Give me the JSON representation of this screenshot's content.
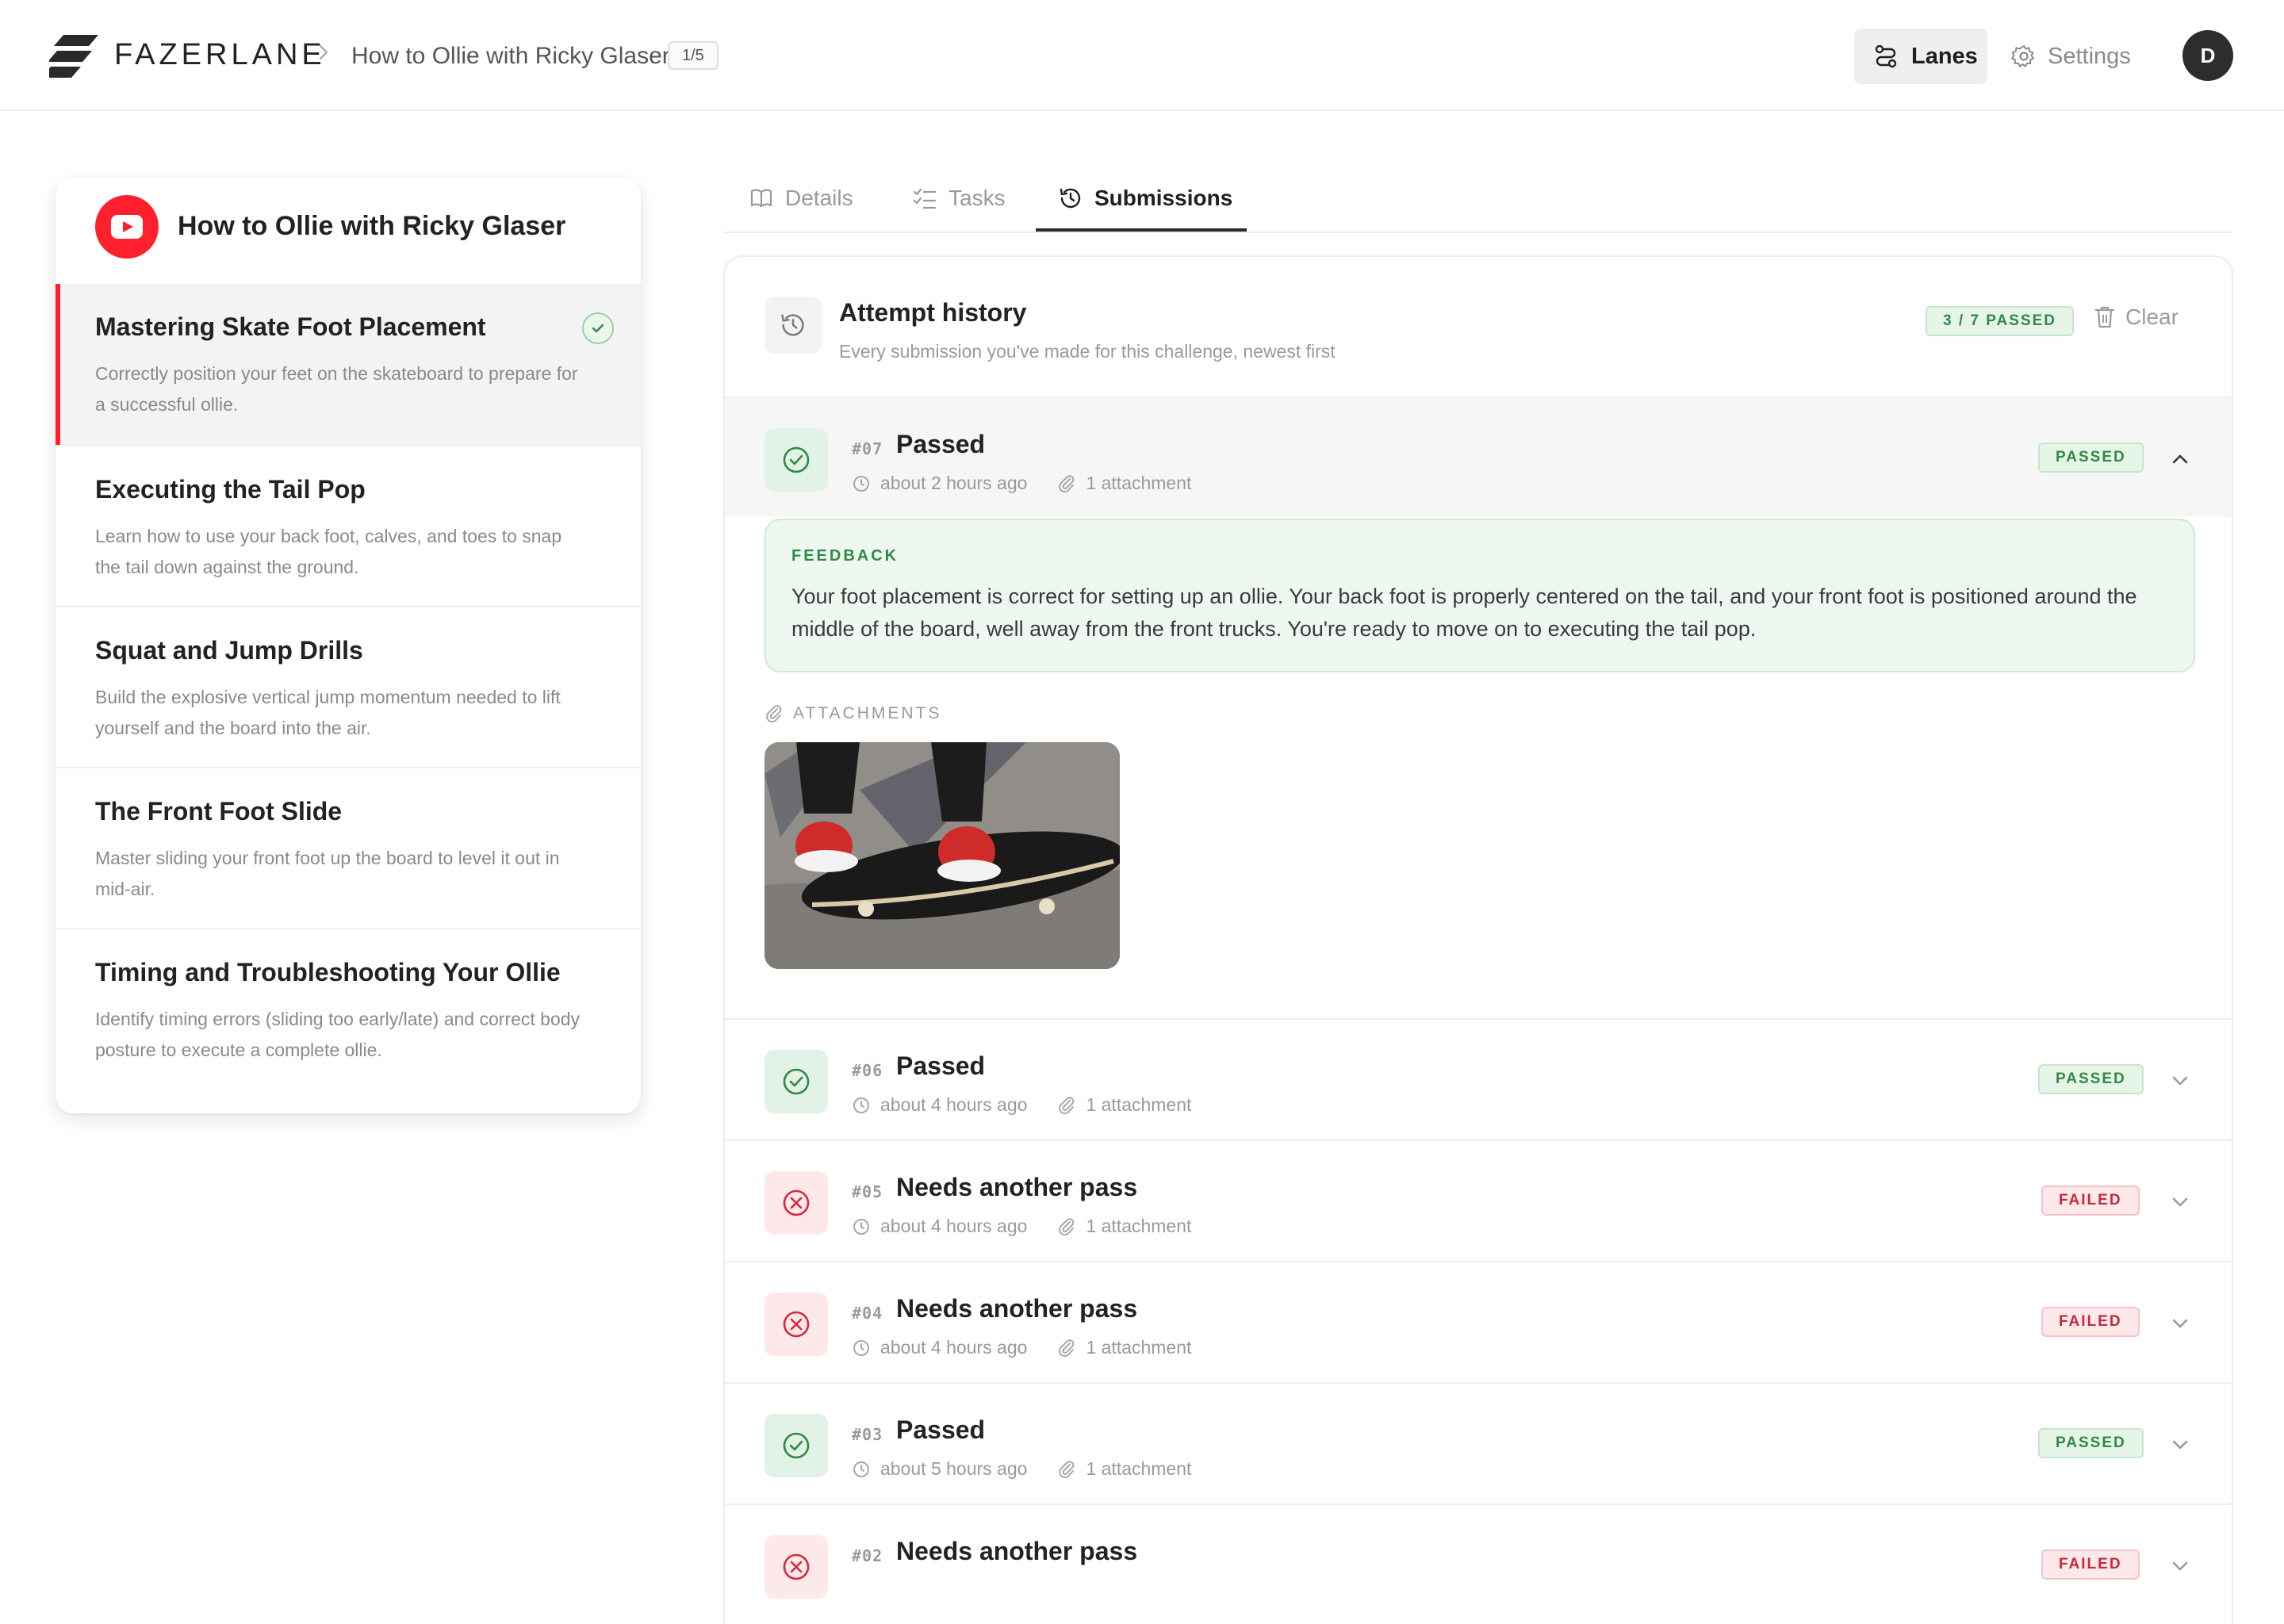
{
  "header": {
    "brand": "FAZERLANE",
    "breadcrumb": "How to Ollie with Ricky Glaser",
    "breadcrumb_count": "1/5",
    "nav": {
      "lanes": "Lanes",
      "settings": "Settings"
    },
    "avatar_initial": "D"
  },
  "lessons_panel": {
    "title": "How to Ollie with Ricky Glaser",
    "items": [
      {
        "title": "Mastering Skate Foot Placement",
        "description": "Correctly position your feet on the skateboard to prepare for a successful ollie.",
        "completed": true
      },
      {
        "title": "Executing the Tail Pop",
        "description": "Learn how to use your back foot, calves, and toes to snap the tail down against the ground.",
        "completed": false
      },
      {
        "title": "Squat and Jump Drills",
        "description": "Build the explosive vertical jump momentum needed to lift yourself and the board into the air.",
        "completed": false
      },
      {
        "title": "The Front Foot Slide",
        "description": "Master sliding your front foot up the board to level it out in mid-air.",
        "completed": false
      },
      {
        "title": "Timing and Troubleshooting Your Ollie",
        "description": "Identify timing errors (sliding too early/late) and correct body posture to execute a complete ollie.",
        "completed": false
      }
    ]
  },
  "tabs": {
    "details": "Details",
    "tasks": "Tasks",
    "submissions": "Submissions",
    "active": "Submissions"
  },
  "history": {
    "title": "Attempt history",
    "subtitle": "Every submission you've made for this challenge, newest first",
    "summary_badge": "3 / 7 PASSED",
    "clear_label": "Clear",
    "feedback_label": "FEEDBACK",
    "feedback_text": "Your foot placement is correct for setting up an ollie. Your back foot is properly centered on the tail, and your front foot is positioned around the middle of the board, well away from the front trucks. You're ready to move on to executing the tail pop.",
    "attachments_label": "ATTACHMENTS",
    "submissions": [
      {
        "number": "#07",
        "title": "Passed",
        "time": "about 2 hours ago",
        "attachments": "1 attachment",
        "status": "PASSED",
        "expanded": true
      },
      {
        "number": "#06",
        "title": "Passed",
        "time": "about 4 hours ago",
        "attachments": "1 attachment",
        "status": "PASSED",
        "expanded": false
      },
      {
        "number": "#05",
        "title": "Needs another pass",
        "time": "about 4 hours ago",
        "attachments": "1 attachment",
        "status": "FAILED",
        "expanded": false
      },
      {
        "number": "#04",
        "title": "Needs another pass",
        "time": "about 4 hours ago",
        "attachments": "1 attachment",
        "status": "FAILED",
        "expanded": false
      },
      {
        "number": "#03",
        "title": "Passed",
        "time": "about 5 hours ago",
        "attachments": "1 attachment",
        "status": "PASSED",
        "expanded": false
      },
      {
        "number": "#02",
        "title": "Needs another pass",
        "time": "",
        "attachments": "",
        "status": "FAILED",
        "expanded": false
      }
    ]
  },
  "colors": {
    "accent_red": "#ff1f2d",
    "pass_green": "#2f8a45",
    "fail_red": "#c8283a"
  }
}
